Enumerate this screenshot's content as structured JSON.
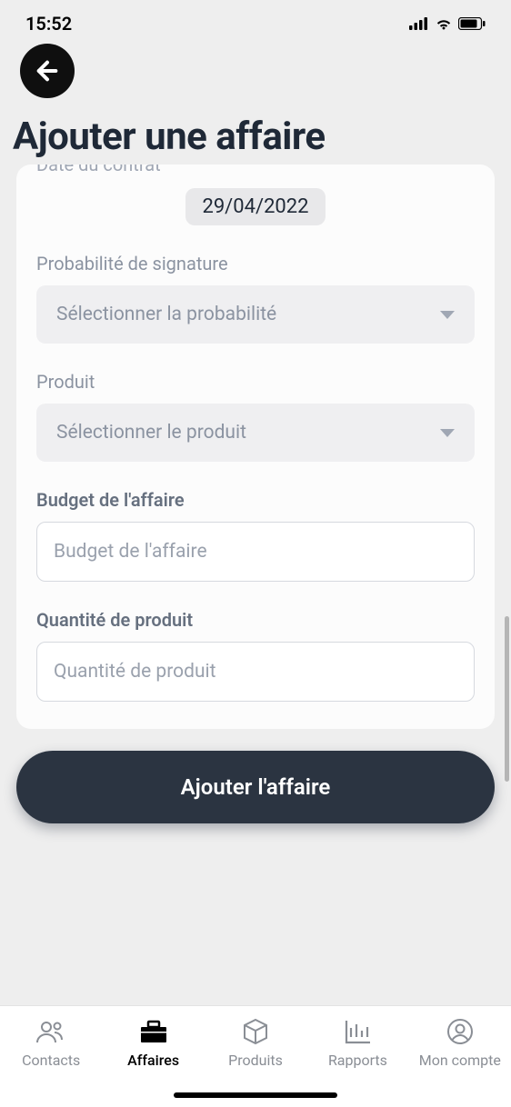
{
  "status": {
    "time": "15:52"
  },
  "header": {
    "title": "Ajouter une affaire"
  },
  "form": {
    "date_label_cut": "Date du contrat",
    "date_value": "29/04/2022",
    "probability": {
      "label": "Probabilité de signature",
      "placeholder": "Sélectionner la probabilité"
    },
    "product": {
      "label": "Produit",
      "placeholder": "Sélectionner le produit"
    },
    "budget": {
      "label": "Budget de l'affaire",
      "placeholder": "Budget de l'affaire"
    },
    "quantity": {
      "label": "Quantité de produit",
      "placeholder": "Quantité de produit"
    },
    "submit": "Ajouter l'affaire"
  },
  "tabs": {
    "contacts": "Contacts",
    "affaires": "Affaires",
    "produits": "Produits",
    "rapports": "Rapports",
    "compte": "Mon compte"
  }
}
